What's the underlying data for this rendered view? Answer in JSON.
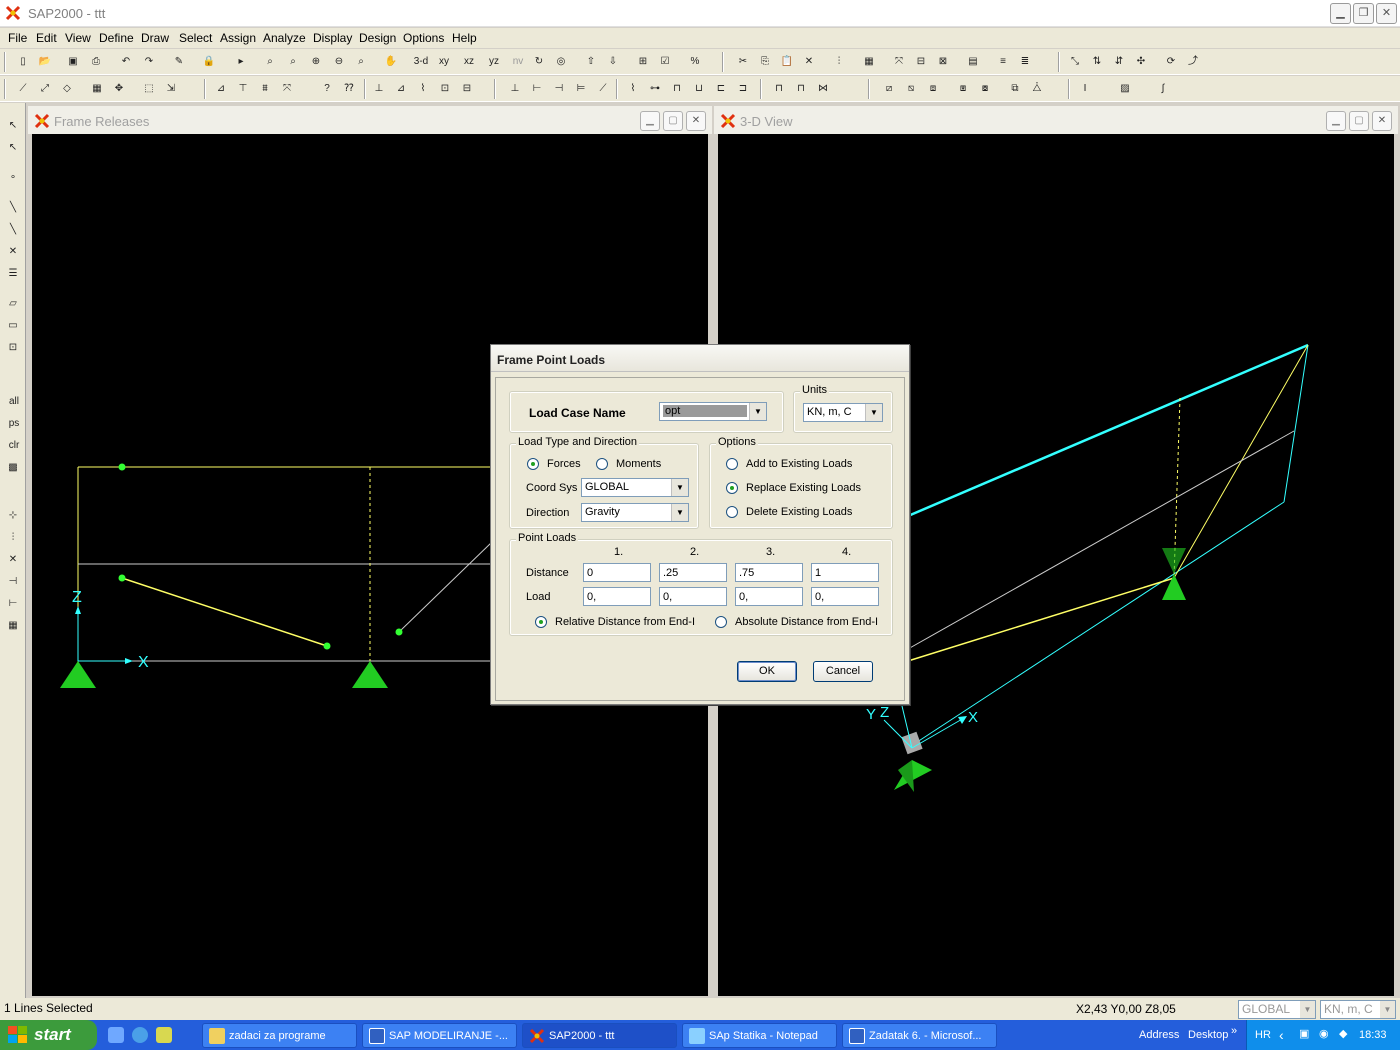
{
  "window": {
    "title": "SAP2000 - ttt",
    "icon": "sap-x-icon"
  },
  "menubar": {
    "items": [
      "File",
      "Edit",
      "View",
      "Define",
      "Draw",
      "Select",
      "Assign",
      "Analyze",
      "Display",
      "Design",
      "Options",
      "Help"
    ]
  },
  "toolbar1": {
    "view_labels": [
      "3-d",
      "xy",
      "xz",
      "yz",
      "nv"
    ]
  },
  "left_toolbar": {
    "labels": [
      "all",
      "ps",
      "clr"
    ]
  },
  "windows": {
    "left": {
      "title": "Frame Releases"
    },
    "right": {
      "title": "3-D View"
    }
  },
  "axes": {
    "left": {
      "z": "Z",
      "x": "X"
    },
    "right": {
      "y": "Y",
      "z": "Z",
      "x": "X"
    }
  },
  "colors": {
    "frame_yellow": "#ffff66",
    "frame_cyan": "#33ffff",
    "support_green": "#22cc22",
    "joint_green": "#33ff33",
    "canvas_bg": "#000000"
  },
  "dialog": {
    "title": "Frame Point Loads",
    "load_case": {
      "label": "Load Case Name",
      "value": "opt"
    },
    "units": {
      "group_title": "Units",
      "value": "KN, m, C"
    },
    "load_type": {
      "group_title": "Load Type and Direction",
      "forces_label": "Forces",
      "moments_label": "Moments",
      "selected": "Forces",
      "coord_sys_label": "Coord Sys",
      "coord_sys_value": "GLOBAL",
      "direction_label": "Direction",
      "direction_value": "Gravity"
    },
    "options": {
      "group_title": "Options",
      "add_label": "Add to Existing Loads",
      "replace_label": "Replace Existing Loads",
      "delete_label": "Delete Existing Loads",
      "selected": "Replace Existing Loads"
    },
    "point_loads": {
      "group_title": "Point Loads",
      "columns": [
        "1.",
        "2.",
        "3.",
        "4."
      ],
      "distance_label": "Distance",
      "load_label": "Load",
      "distances": [
        "0",
        ".25",
        ".75",
        "1"
      ],
      "loads": [
        "0,",
        "0,",
        "0,",
        "0,"
      ],
      "relative_label": "Relative Distance from End-I",
      "absolute_label": "Absolute Distance from End-I",
      "selected": "Relative Distance from End-I"
    },
    "ok_label": "OK",
    "cancel_label": "Cancel"
  },
  "statusbar": {
    "text": "1 Lines Selected",
    "coords": "X2,43  Y0,00  Z8,05",
    "coord_sys": "GLOBAL",
    "units": "KN, m, C"
  },
  "taskbar": {
    "start_label": "start",
    "tasks": [
      {
        "label": "zadaci za programe",
        "icon": "folder-icon"
      },
      {
        "label": "SAP  MODELIRANJE -...",
        "icon": "word-doc-icon"
      },
      {
        "label": "SAP2000 - ttt",
        "icon": "sap-x-icon"
      },
      {
        "label": "SAp Statika - Notepad",
        "icon": "notepad-icon"
      },
      {
        "label": "Zadatak 6. - Microsof...",
        "icon": "word-doc-icon"
      }
    ],
    "address_label": "Address",
    "desktop_label": "Desktop",
    "lang": "HR",
    "clock": "18:33"
  }
}
